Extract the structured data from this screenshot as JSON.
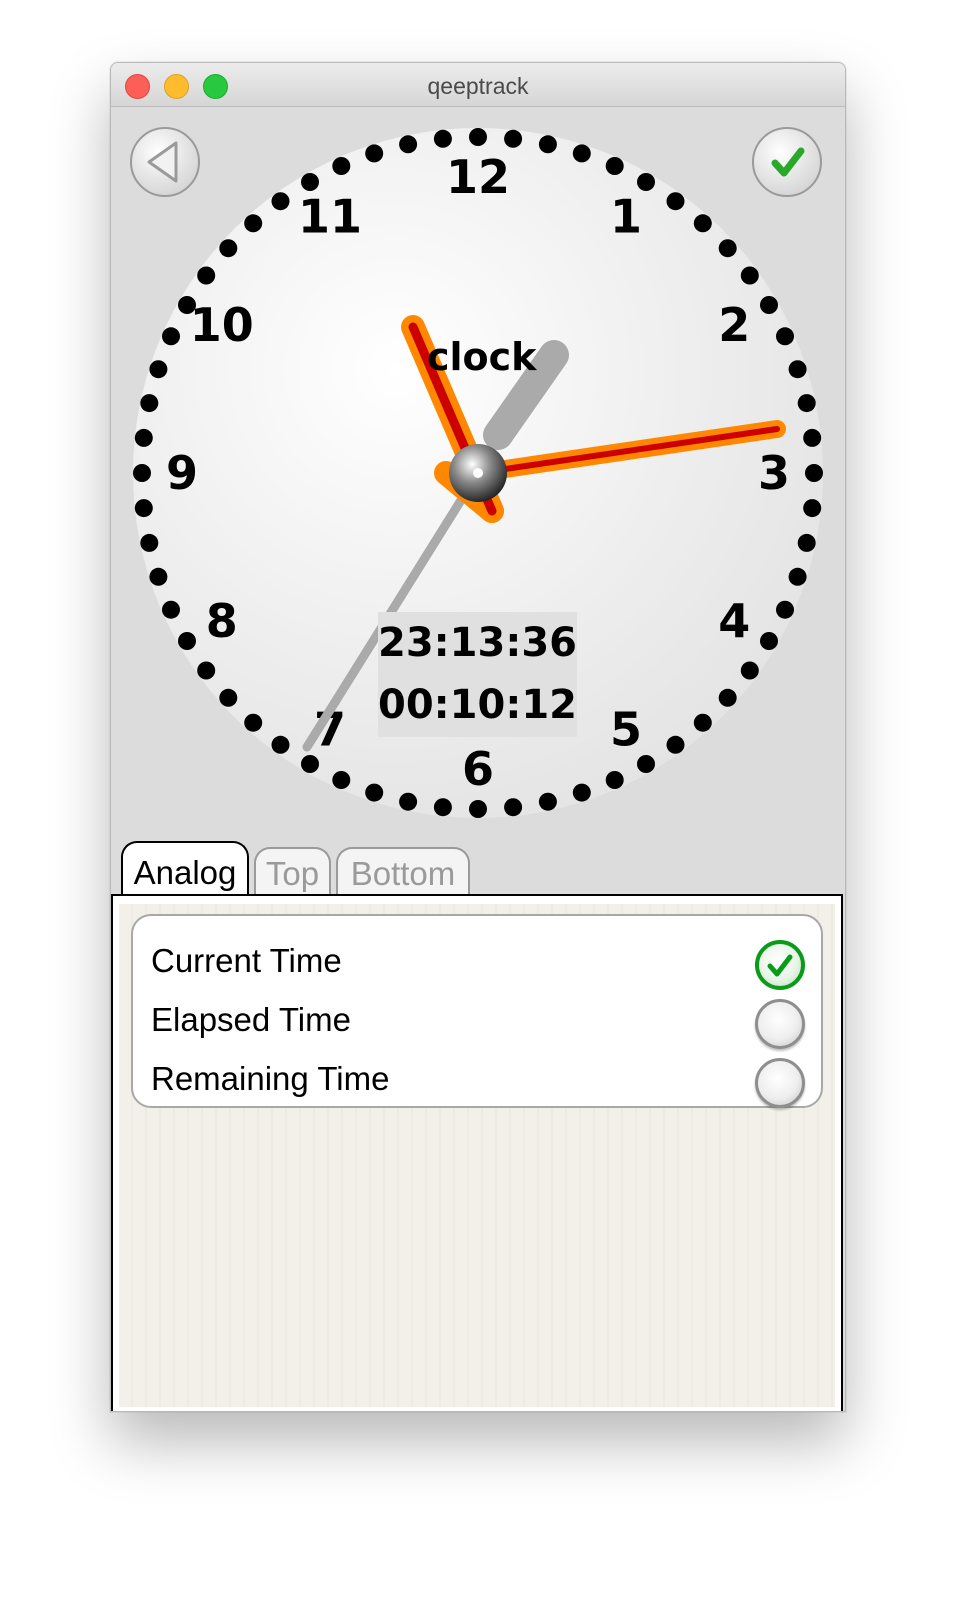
{
  "window": {
    "title": "qeeptrack"
  },
  "clock": {
    "label": "clock",
    "numerals": [
      "12",
      "1",
      "2",
      "3",
      "4",
      "5",
      "6",
      "7",
      "8",
      "9",
      "10",
      "11"
    ],
    "current_time": "23:13:36",
    "elapsed_time": "00:10:12",
    "hands": {
      "hour_hand_color": "#cc0000",
      "minute_hand_color": "#cc0000",
      "hand_outline_color": "#ff8800",
      "second_hand_color": "#aaaaaa"
    }
  },
  "toolbar": {
    "back_icon": "back-arrow-icon",
    "ok_icon": "checkmark-icon"
  },
  "tabs": [
    {
      "label": "Analog",
      "active": true
    },
    {
      "label": "Top",
      "active": false
    },
    {
      "label": "Bottom",
      "active": false
    }
  ],
  "options": [
    {
      "label": "Current Time",
      "selected": true
    },
    {
      "label": "Elapsed Time",
      "selected": false
    },
    {
      "label": "Remaining Time",
      "selected": false
    }
  ],
  "colors": {
    "accent_green": "#0a9b18",
    "traffic_red": "#fc5f57",
    "traffic_yellow": "#fdbc2e",
    "traffic_green": "#28c840"
  }
}
